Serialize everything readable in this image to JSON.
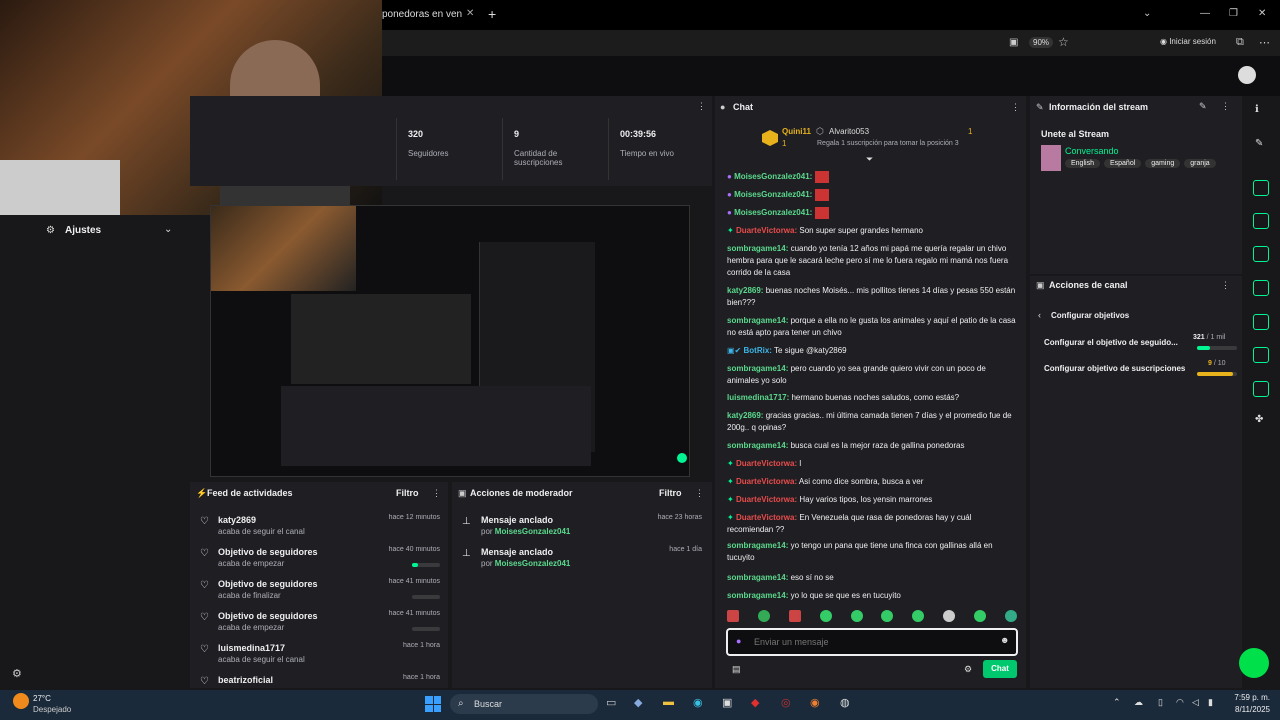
{
  "browser": {
    "tab_title": "ponedoras en venezuel",
    "new_tab": "+",
    "zoom": "90%",
    "signin": "Iniciar sesión"
  },
  "stats": {
    "followers_value": "320",
    "followers_label": "Seguidores",
    "subs_value": "9",
    "subs_label": "Cantidad de suscripciones",
    "time_value": "00:39:56",
    "time_label": "Tiempo en vivo"
  },
  "settings_label": "Ajustes",
  "chat": {
    "title": "Chat",
    "top1_user": "Quini11",
    "top1_count": "1",
    "top2_user": "Alvarito053",
    "top2_count": "1",
    "top_note": "Regala 1 suscripción para tomar la posición 3",
    "messages": [
      {
        "user": "MoisesGonzalez041:",
        "text": ""
      },
      {
        "user": "MoisesGonzalez041:",
        "text": ""
      },
      {
        "user": "MoisesGonzalez041:",
        "text": ""
      },
      {
        "user": "DuarteVictorwa:",
        "text": " Son super super grandes hermano"
      },
      {
        "user": "sombragame14:",
        "text": " cuando yo tenía 12 años mi papá me quería regalar un chivo hembra para que le sacará leche pero sí me lo fuera regalo mi mamá nos fuera corrido de la casa"
      },
      {
        "user": "katy2869:",
        "text": " buenas noches Moisés... mis pollitos tienes 14 días y pesas 550 están bien???"
      },
      {
        "user": "sombragame14:",
        "text": " porque a ella no le gusta los animales y aquí el patio de la casa no está apto para tener un chivo"
      },
      {
        "user": "BotRix:",
        "text": " Te sigue @katy2869"
      },
      {
        "user": "sombragame14:",
        "text": " pero cuando yo sea grande quiero vivir con un poco de animales yo solo"
      },
      {
        "user": "luismedina1717:",
        "text": " hermano buenas noches saludos, como estás?"
      },
      {
        "user": "katy2869:",
        "text": " gracias gracias.. mi última camada tienen 7 días y el promedio fue de 200g.. q opinas?"
      },
      {
        "user": "sombragame14:",
        "text": " busca cual es la mejor raza de gallina ponedoras"
      },
      {
        "user": "DuarteVictorwa:",
        "text": " l"
      },
      {
        "user": "DuarteVictorwa:",
        "text": " Asi como dice sombra, busca a ver"
      },
      {
        "user": "DuarteVictorwa:",
        "text": " Hay varios tipos, los yensin marrones"
      },
      {
        "user": "DuarteVictorwa:",
        "text": " En Venezuela que rasa de ponedoras hay y cuál recomiendan ??"
      },
      {
        "user": "sombragame14:",
        "text": " yo tengo un pana que tiene una finca con gallinas allá en tucuyito"
      },
      {
        "user": "sombragame14:",
        "text": " eso sí no se"
      },
      {
        "user": "sombragame14:",
        "text": " yo lo que se que es en tucuyito"
      }
    ],
    "input_placeholder": "Enviar un mensaje",
    "send_label": "Chat"
  },
  "stream_info": {
    "title": "Información del stream",
    "stream_title": "Unete al Stream",
    "category": "Conversando",
    "tags": [
      "English",
      "Español",
      "gaming",
      "granja"
    ]
  },
  "channel_actions": {
    "title": "Acciones de canal",
    "back_label": "Configurar objetivos",
    "goal1_label": "Configurar el objetivo de seguido...",
    "goal1_value": "321",
    "goal1_total": "/ 1 mil",
    "goal1_fraction": 0.32,
    "goal2_label": "Configurar objetivo de suscripciones",
    "goal2_value": "9",
    "goal2_total": "/ 10",
    "goal2_fraction": 0.9
  },
  "activity": {
    "title": "Feed de actividades",
    "filter": "Filtro",
    "items": [
      {
        "title": "katy2869",
        "sub": "acaba de seguir el canal",
        "time": "hace 12 minutos"
      },
      {
        "title": "Objetivo de seguidores",
        "sub": "acaba de empezar",
        "time": "hace 40 minutos"
      },
      {
        "title": "Objetivo de seguidores",
        "sub": "acaba de finalizar",
        "time": "hace 41 minutos"
      },
      {
        "title": "Objetivo de seguidores",
        "sub": "acaba de empezar",
        "time": "hace 41 minutos"
      },
      {
        "title": "luismedina1717",
        "sub": "acaba de seguir el canal",
        "time": "hace 1 hora"
      },
      {
        "title": "beatrizoficial",
        "sub": "",
        "time": "hace 1 hora"
      }
    ]
  },
  "mod": {
    "title": "Acciones de moderador",
    "filter": "Filtro",
    "items": [
      {
        "title": "Mensaje anclado",
        "by": "por",
        "user": "MoisesGonzalez041",
        "time": "hace 23 horas"
      },
      {
        "title": "Mensaje anclado",
        "by": "por",
        "user": "MoisesGonzalez041",
        "time": "hace 1 día"
      }
    ]
  },
  "taskbar": {
    "temp": "27°C",
    "weather": "Despejado",
    "search": "Buscar",
    "time": "7:59 p. m.",
    "date": "8/11/2025"
  }
}
